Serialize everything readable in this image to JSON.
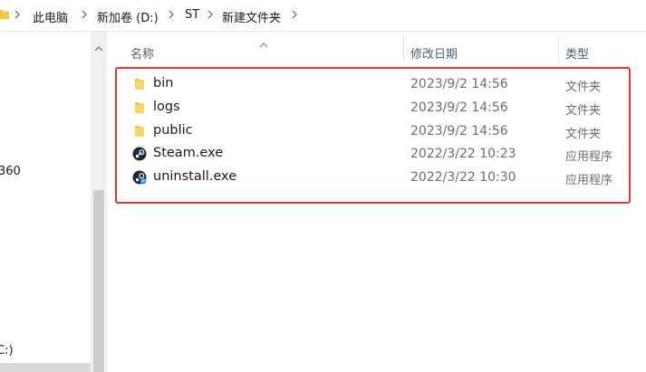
{
  "breadcrumb": {
    "items": [
      "此电脑",
      "新加卷 (D:)",
      "ST",
      "新建文件夹"
    ]
  },
  "navpane": {
    "items": [
      "360",
      "C:)"
    ]
  },
  "columns": {
    "name": "名称",
    "date": "修改日期",
    "type": "类型"
  },
  "files": [
    {
      "name": "bin",
      "date": "2023/9/2 14:56",
      "type": "文件夹",
      "icon": "folder-icon"
    },
    {
      "name": "logs",
      "date": "2023/9/2 14:56",
      "type": "文件夹",
      "icon": "folder-icon"
    },
    {
      "name": "public",
      "date": "2023/9/2 14:56",
      "type": "文件夹",
      "icon": "folder-icon"
    },
    {
      "name": "Steam.exe",
      "date": "2022/3/22 10:23",
      "type": "应用程序",
      "icon": "steam-icon"
    },
    {
      "name": "uninstall.exe",
      "date": "2022/3/22 10:30",
      "type": "应用程序",
      "icon": "uninstall-steam-icon"
    }
  ],
  "colors": {
    "highlight": "#d93a35",
    "folder": "#f3c64a",
    "header_text": "#4c607a"
  }
}
